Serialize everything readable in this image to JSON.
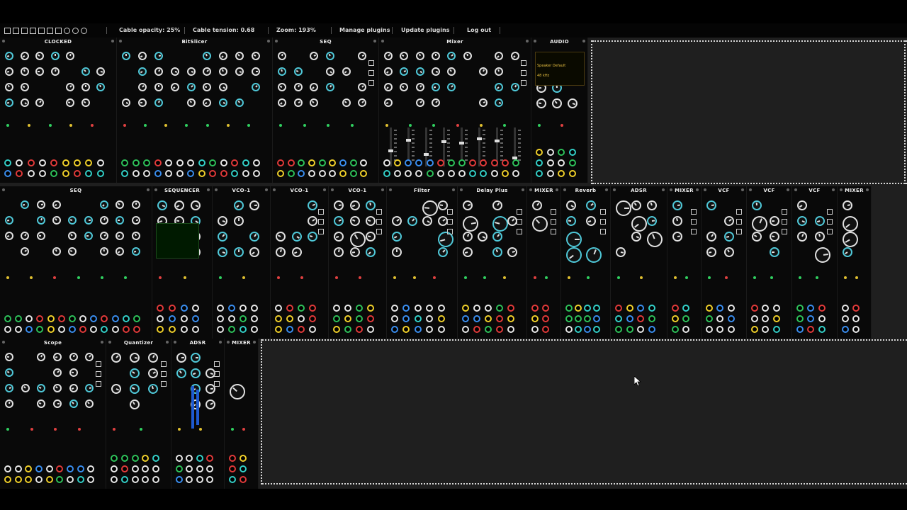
{
  "toolbar": {
    "icons": [
      "file-new-icon",
      "file-open-icon",
      "file-save-icon",
      "file-saveas-icon",
      "undo-icon",
      "redo-icon",
      "clear-icon",
      "help-icon",
      "settings-icon",
      "power-icon"
    ],
    "cable_opacity": "Cable opacity: 25%",
    "cable_tension": "Cable tension: 0.68",
    "zoom": "Zoom: 193%",
    "manage_plugins": "Manage plugins",
    "update_plugins": "Update plugins",
    "log_out": "Log out"
  },
  "modules": {
    "row1": [
      {
        "title": "CLOCKED",
        "w": 165
      },
      {
        "title": "BitSlicer",
        "w": 220
      },
      {
        "title": "SEQ",
        "w": 150
      },
      {
        "title": "Mixer",
        "w": 215
      },
      {
        "title": "AUDIO",
        "w": 80
      }
    ],
    "row2": [
      {
        "title": "SEQ",
        "w": 215
      },
      {
        "title": "SEQUENCER",
        "w": 85
      },
      {
        "title": "VCO-1",
        "w": 82
      },
      {
        "title": "VCO-1",
        "w": 82
      },
      {
        "title": "VCO-1",
        "w": 82
      },
      {
        "title": "Filter",
        "w": 100
      },
      {
        "title": "Delay Plus",
        "w": 98
      },
      {
        "title": "MIXER",
        "w": 48
      },
      {
        "title": "Reverb",
        "w": 70
      },
      {
        "title": "ADSR",
        "w": 80
      },
      {
        "title": "MIXER",
        "w": 48
      },
      {
        "title": "VCF",
        "w": 64
      },
      {
        "title": "VCF",
        "w": 64
      },
      {
        "title": "VCF",
        "w": 64
      },
      {
        "title": "MIXER",
        "w": 48
      }
    ],
    "row3": [
      {
        "title": "Scope",
        "w": 150
      },
      {
        "title": "Quantizer",
        "w": 92
      },
      {
        "title": "ADSR",
        "w": 75
      },
      {
        "title": "MIXER",
        "w": 48
      }
    ]
  },
  "labels": {
    "audio_display": "Speaker Default",
    "audio_rate": "48 kHz"
  },
  "colors": {
    "rack_bg": "#1f1f1f",
    "panel_bg": "#090909",
    "divider": "#d9d9d9"
  }
}
